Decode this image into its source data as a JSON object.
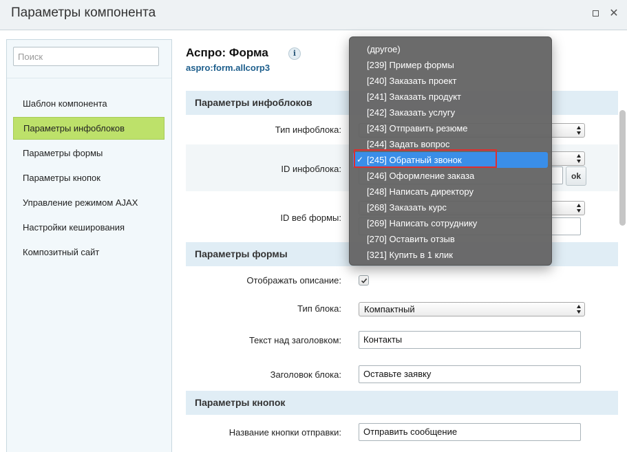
{
  "window": {
    "title": "Параметры компонента"
  },
  "sidebar": {
    "search_placeholder": "Поиск",
    "items": [
      {
        "label": "Шаблон компонента"
      },
      {
        "label": "Параметры инфоблоков"
      },
      {
        "label": "Параметры формы"
      },
      {
        "label": "Параметры кнопок"
      },
      {
        "label": "Управление режимом AJAX"
      },
      {
        "label": "Настройки кеширования"
      },
      {
        "label": "Композитный сайт"
      }
    ],
    "active_index": 1
  },
  "component": {
    "title": "Аспро: Форма",
    "code": "aspro:form.allcorp3",
    "info_glyph": "i"
  },
  "sections": {
    "infoblock": {
      "header": "Параметры инфоблоков",
      "type_label": "Тип инфоблока:",
      "id_label": "ID инфоблока:",
      "ok_label": "ok",
      "webform_label": "ID веб формы:"
    },
    "form": {
      "header": "Параметры формы",
      "show_desc_label": "Отображать описание:",
      "show_desc_checked": true,
      "block_type_label": "Тип блока:",
      "block_type_value": "Компактный",
      "text_above_label": "Текст над заголовком:",
      "text_above_value": "Контакты",
      "block_title_label": "Заголовок блока:",
      "block_title_value": "Оставьте заявку"
    },
    "buttons": {
      "header": "Параметры кнопок",
      "submit_label": "Название кнопки отправки:",
      "submit_value": "Отправить сообщение"
    }
  },
  "dropdown": {
    "options": [
      "(другое)",
      "[239] Пример формы",
      "[240] Заказать проект",
      "[241] Заказать продукт",
      "[242] Заказать услугу",
      "[243] Отправить резюме",
      "[244] Задать вопрос",
      "[245] Обратный звонок",
      "[246] Оформление заказа",
      "[248] Написать директору",
      "[268] Заказать курс",
      "[269] Написать сотруднику",
      "[270] Оставить отзыв",
      "[321] Купить в 1 клик"
    ],
    "selected_index": 7,
    "check_glyph": "✓",
    "selected_color": "#3a8ee8",
    "highlight_color": "#e02d2d"
  }
}
